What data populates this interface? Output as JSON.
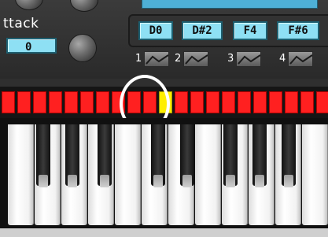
{
  "attack": {
    "label": "ttack",
    "value": "0"
  },
  "notes": [
    "D0",
    "D#2",
    "F4",
    "F#6"
  ],
  "slots": [
    "1",
    "2",
    "3",
    "4"
  ],
  "sequencer": {
    "active_step_number": 11,
    "step_color": "#ff2020",
    "active_color": "#ffee00"
  },
  "colors": {
    "chip": "#8ee0f4",
    "ring": "#ffffff"
  }
}
